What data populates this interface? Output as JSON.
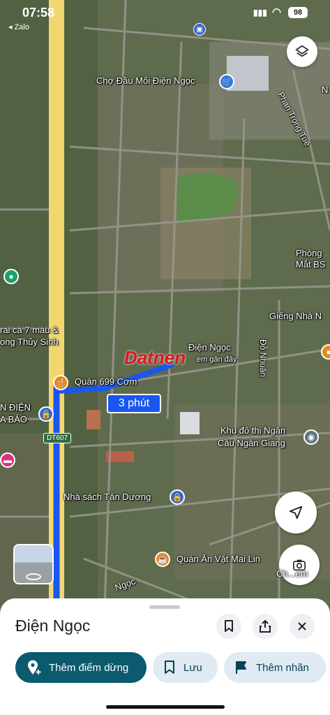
{
  "status_bar": {
    "time": "07:58",
    "back_app": "◂ Zalo",
    "battery": "98"
  },
  "map": {
    "labels": {
      "cho_dau_moi": "Chợ Đầu Mối Điện Ngọc",
      "phan_trong_tue": "Phan Trọng Tuệ",
      "phong_mat_1": "Phòng",
      "phong_mat_2": "Mắt BS",
      "trai_ca_1": "rai cá 7 màu &",
      "trai_ca_2": "ong Thủy Sinh",
      "gieng_nha": "Giếng Nhà N",
      "dien_ngoc_1": "Điện Ngọc",
      "dien_ngoc_2": "em gần đây",
      "do_nhuan": "Đỗ Nhuận",
      "quan_699": "Quán 699 Cơm",
      "route_time": "3 phút",
      "dien_bao_1": "N ĐIỆN",
      "dien_bao_2": "A BẢO",
      "dt607": "DT607",
      "khu_do_thi_1": "Khu đô thị Ngân",
      "khu_do_thi_2": "Cầu Ngân Giang",
      "nha_sach": "Nhà sách Tân Dương",
      "quan_an_vat": "Quán Ăn Vặt Mai Lin",
      "ngoc": "Ngọc",
      "watermark": "Datnen",
      "streetview_btn": "Ch...em",
      "tag_n": "N"
    },
    "route_color": "#1a56f0",
    "highway_color": "#f2d770"
  },
  "sheet": {
    "place_title": "Điện Ngọc",
    "actions": {
      "add_stop": "Thêm điểm dừng",
      "save": "Lưu",
      "label": "Thêm nhãn"
    }
  }
}
